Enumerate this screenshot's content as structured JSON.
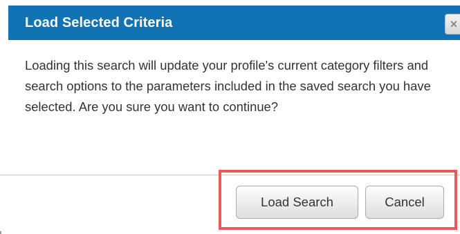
{
  "dialog": {
    "title": "Load Selected Criteria",
    "close_symbol": "×",
    "close_icon": "close-icon",
    "message": "Loading this search will update your profile's current category filters and search options to the parameters included in the saved search you have selected. Are you sure you want to continue?",
    "buttons": {
      "load_label": "Load Search",
      "cancel_label": "Cancel"
    }
  },
  "colors": {
    "title_bar": "#1273b4",
    "highlight": "#e85b5b",
    "text": "#333333"
  }
}
